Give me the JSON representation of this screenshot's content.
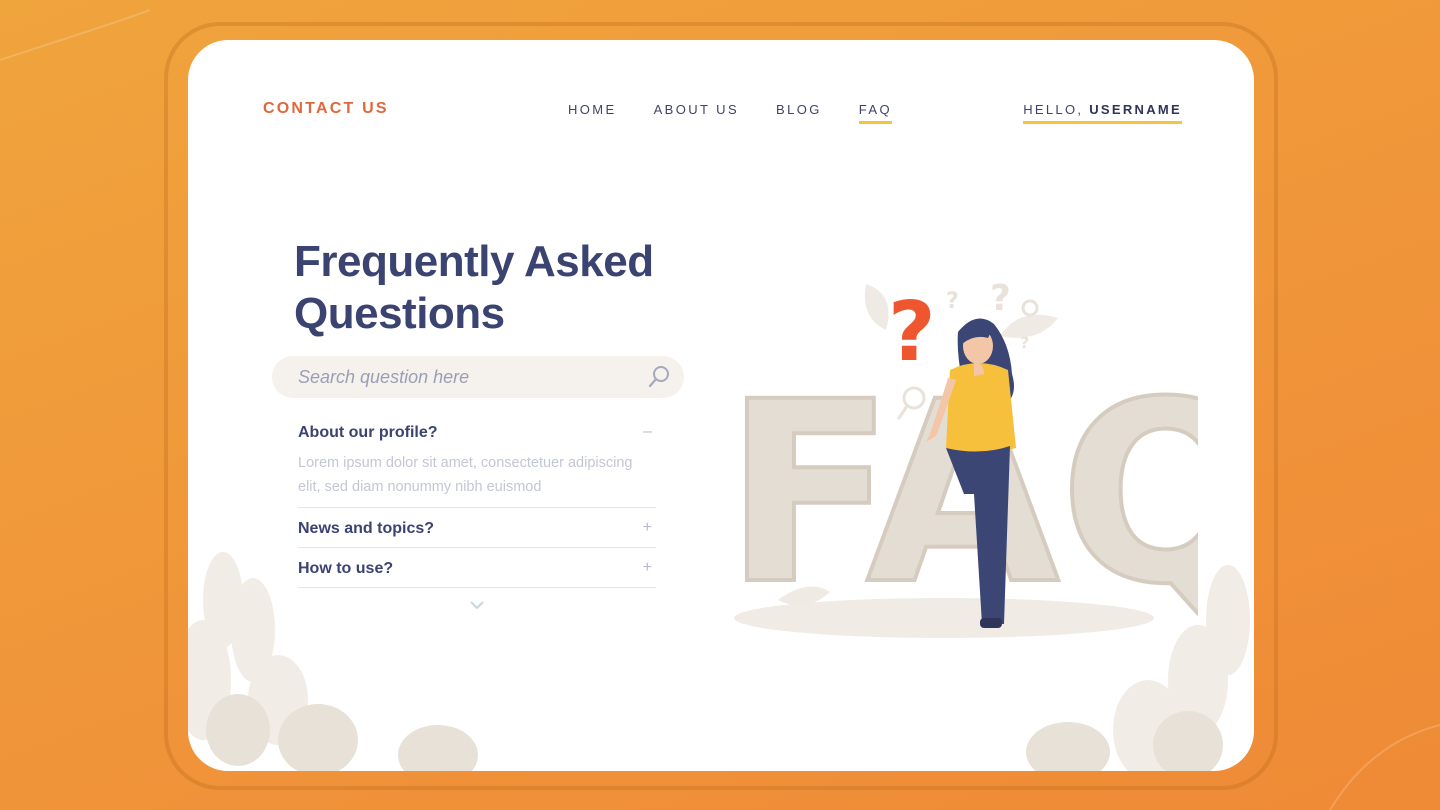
{
  "brand": {
    "label": "CONTACT US"
  },
  "nav": {
    "items": [
      "HOME",
      "ABOUT US",
      "BLOG",
      "FAQ"
    ],
    "active_index": 3
  },
  "user": {
    "greeting": "HELLO,",
    "username": "USERNAME"
  },
  "hero": {
    "title_line1": "Frequently Asked",
    "title_line2": "Questions"
  },
  "search": {
    "placeholder": "Search question here",
    "value": ""
  },
  "faq": {
    "items": [
      {
        "question": "About our profile?",
        "answer": "Lorem ipsum dolor sit amet, consectetuer adipiscing elit, sed diam nonummy nibh euismod",
        "toggle": "–",
        "expanded": true
      },
      {
        "question": "News and topics?",
        "toggle": "+",
        "expanded": false
      },
      {
        "question": "How to use?",
        "toggle": "+",
        "expanded": false
      }
    ]
  },
  "illustration": {
    "letters": "FAQ",
    "mark": "?"
  },
  "icons": [
    "search-icon",
    "chevron-down-icon",
    "question-mark-icon",
    "leaf-icon",
    "magnifier-icon"
  ],
  "colors": {
    "background": "#f0993a",
    "brand_accent": "#e0673a",
    "heading": "#3b4370",
    "underline_accent": "#f3c43c",
    "search_bg": "#f5f1ec",
    "muted_text": "#c3c7d4"
  }
}
